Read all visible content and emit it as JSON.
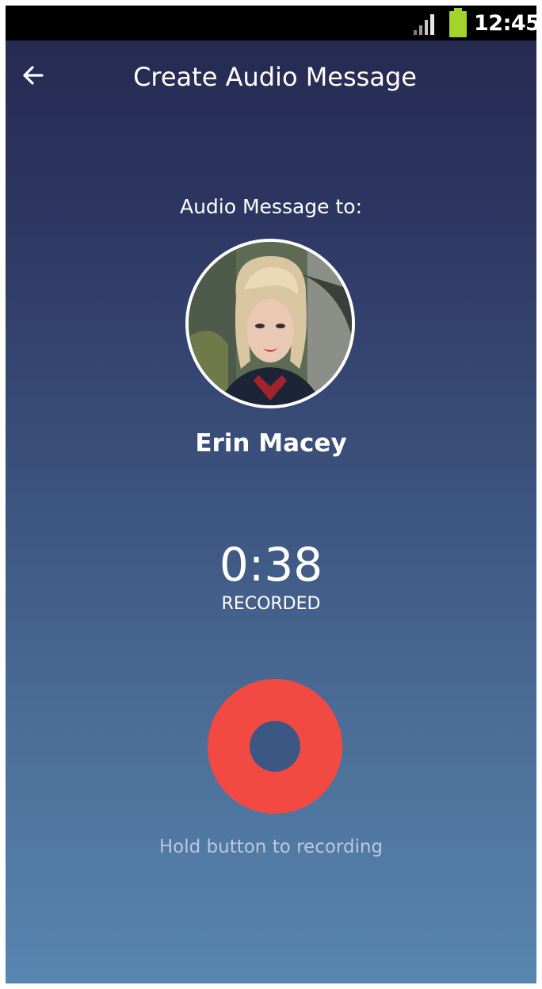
{
  "status_bar": {
    "time": "12:45",
    "signal_icon": "signal-icon",
    "battery_icon": "battery-icon",
    "battery_color": "#a4d32b"
  },
  "app_bar": {
    "title": "Create Audio Message",
    "back_icon": "arrow-left-icon"
  },
  "recipient": {
    "label": "Audio Message to:",
    "name": "Erin Macey"
  },
  "recording": {
    "duration": "0:38",
    "status": "RECORDED",
    "hint": "Hold button to recording",
    "button_color": "#f24a43"
  }
}
